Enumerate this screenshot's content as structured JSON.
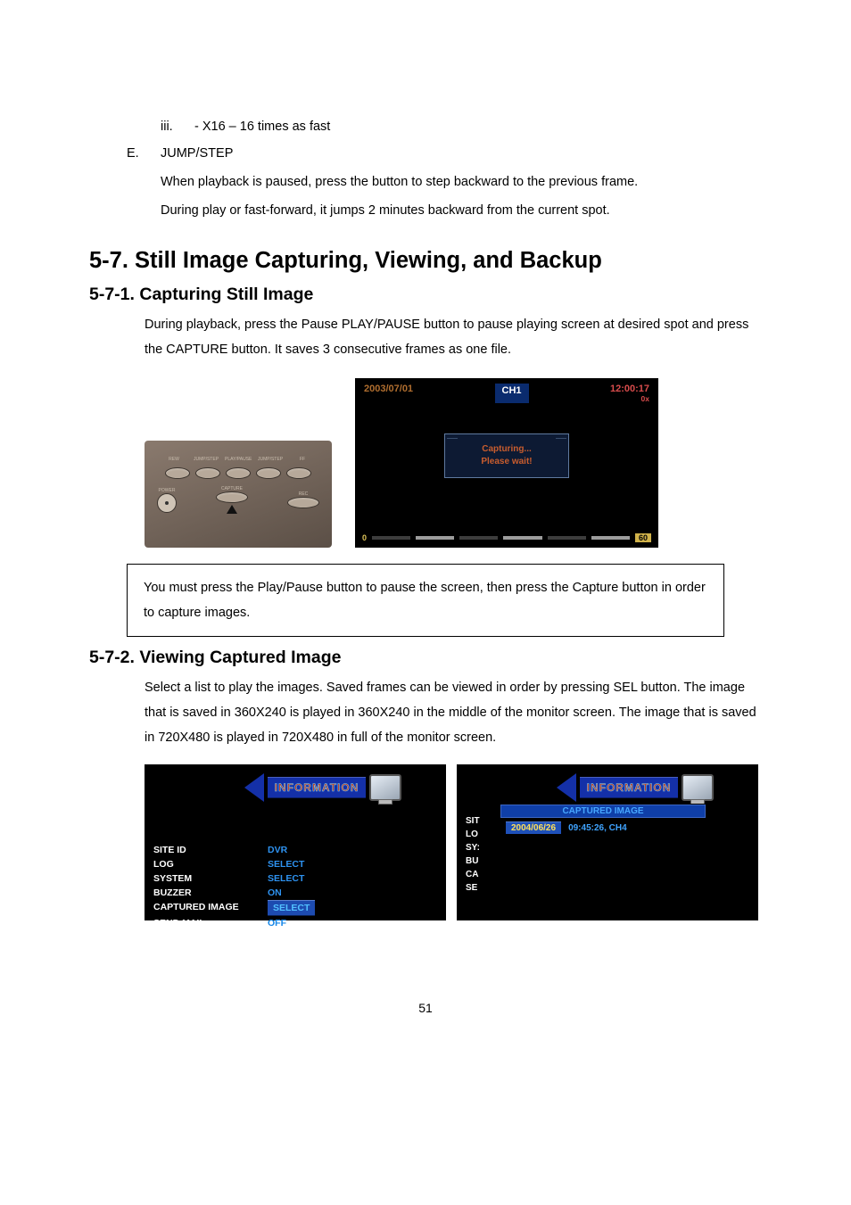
{
  "list_iii": {
    "marker": "iii.",
    "text": "- X16 – 16 times as fast"
  },
  "list_E": {
    "marker": "E.",
    "title": "JUMP/STEP",
    "p1": "When playback is paused, press the button to step backward to the previous frame.",
    "p2": "During play or fast-forward, it jumps 2 minutes backward from the current spot."
  },
  "section_5_7": "5-7. Still Image Capturing, Viewing, and Backup",
  "section_5_7_1": {
    "title": "5-7-1. Capturing Still Image",
    "p1": "During playback, press the Pause PLAY/PAUSE button to pause playing screen at desired spot and press the CAPTURE button. It saves 3 consecutive frames as one file."
  },
  "remote": {
    "labels": [
      "REW",
      "JUMP/STEP",
      "PLAY/PAUSE",
      "JUMP/STEP",
      "FF"
    ],
    "power": "POWER",
    "capture": "CAPTURE",
    "rec": "REC"
  },
  "capture_screen": {
    "date": "2003/07/01",
    "channel": "CH1",
    "time": "12:00:17",
    "speed": "0x",
    "dialog_l": "Capturing...",
    "dialog_r": "Please wait!",
    "zero": "0",
    "end": "60"
  },
  "note": "You must press the Play/Pause button to pause the screen, then press the Capture button in order to capture images.",
  "section_5_7_2": {
    "title": "5-7-2. Viewing Captured Image",
    "p1": "Select a list to play the images.    Saved frames can be viewed in order by pressing SEL button.    The image that is saved in 360X240 is played in 360X240 in the middle of the monitor screen. The image that is saved in 720X480 is played in 720X480 in full of the monitor screen."
  },
  "info_banner": "INFORMATION",
  "info_left": {
    "rows": [
      {
        "lbl": "SITE ID",
        "val": "DVR"
      },
      {
        "lbl": "LOG",
        "val": "SELECT"
      },
      {
        "lbl": "SYSTEM",
        "val": "SELECT"
      },
      {
        "lbl": "BUZZER",
        "val": "ON"
      },
      {
        "lbl": "CAPTURED IMAGE",
        "val": "SELECT",
        "selected": true
      },
      {
        "lbl": "SEND MAIL",
        "val": "OFF"
      }
    ]
  },
  "info_right": {
    "truncated": [
      "SIT",
      "LO",
      "SY:",
      "BU",
      "CA",
      "SE"
    ],
    "overlay_title": "CAPTURED IMAGE",
    "overlay_date": "2004/06/26",
    "overlay_label": "09:45:26, CH4"
  },
  "page_num": "51"
}
